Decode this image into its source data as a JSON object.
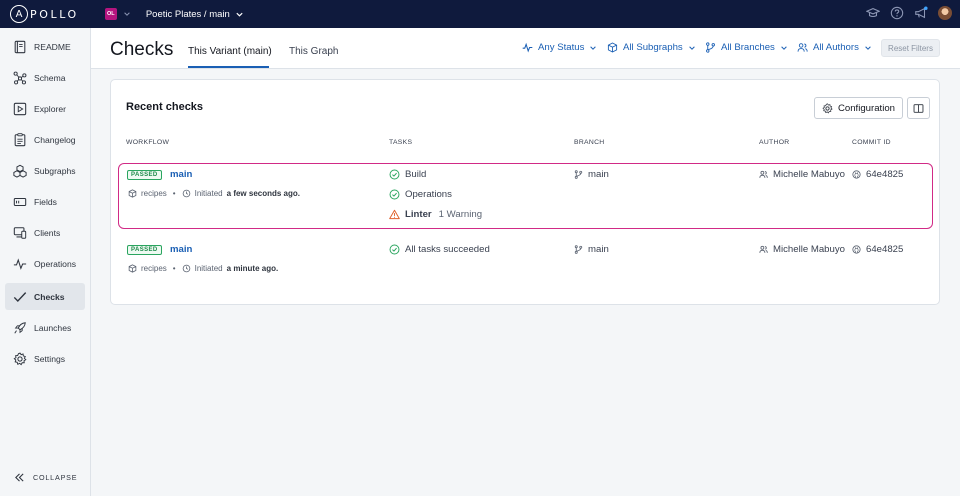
{
  "brand": {
    "logo_letter": "A",
    "logo_rest": "POLLO"
  },
  "org": {
    "initials": "OL"
  },
  "graph": {
    "title": "Poetic Plates / main"
  },
  "sidebar": {
    "items": [
      {
        "label": "README",
        "icon": "book-icon"
      },
      {
        "label": "Schema",
        "icon": "schema-icon"
      },
      {
        "label": "Explorer",
        "icon": "play-icon"
      },
      {
        "label": "Changelog",
        "icon": "changelog-icon"
      },
      {
        "label": "Subgraphs",
        "icon": "subgraphs-icon"
      },
      {
        "label": "Fields",
        "icon": "fields-icon"
      },
      {
        "label": "Clients",
        "icon": "clients-icon"
      },
      {
        "label": "Operations",
        "icon": "pulse-icon"
      },
      {
        "label": "Checks",
        "icon": "check-icon"
      },
      {
        "label": "Launches",
        "icon": "rocket-icon"
      },
      {
        "label": "Settings",
        "icon": "gear-icon"
      }
    ],
    "active": "Checks",
    "collapse_label": "COLLAPSE"
  },
  "header": {
    "title": "Checks",
    "tabs": [
      {
        "label": "This Variant (main)"
      },
      {
        "label": "This Graph"
      }
    ],
    "filters": {
      "status": "Any Status",
      "subgraphs": "All Subgraphs",
      "branches": "All Branches",
      "authors": "All Authors",
      "reset": "Reset Filters"
    }
  },
  "panel": {
    "title": "Recent checks",
    "config_label": "Configuration",
    "columns": {
      "workflow": "WORKFLOW",
      "tasks": "TASKS",
      "branch": "BRANCH",
      "author": "AUTHOR",
      "commit": "COMMIT ID"
    },
    "rows": [
      {
        "status": "PASSED",
        "name": "main",
        "subgraph": "recipes",
        "initiated_prefix": "Initiated",
        "initiated_time": "a few seconds ago.",
        "tasks": [
          {
            "label": "Build",
            "state": "success"
          },
          {
            "label": "Operations",
            "state": "success"
          },
          {
            "label": "Linter",
            "state": "warning",
            "detail": "1 Warning"
          }
        ],
        "branch": "main",
        "author": "Michelle Mabuyo",
        "commit": "64e4825"
      },
      {
        "status": "PASSED",
        "name": "main",
        "subgraph": "recipes",
        "initiated_prefix": "Initiated",
        "initiated_time": "a minute ago.",
        "tasks": [
          {
            "label": "All tasks succeeded",
            "state": "success"
          }
        ],
        "branch": "main",
        "author": "Michelle Mabuyo",
        "commit": "64e4825"
      }
    ]
  },
  "colors": {
    "topbar": "#0f1a3d",
    "accent": "#1a5fb4",
    "success": "#2aa55f",
    "warning": "#e0622c",
    "highlight": "#d12a86"
  }
}
